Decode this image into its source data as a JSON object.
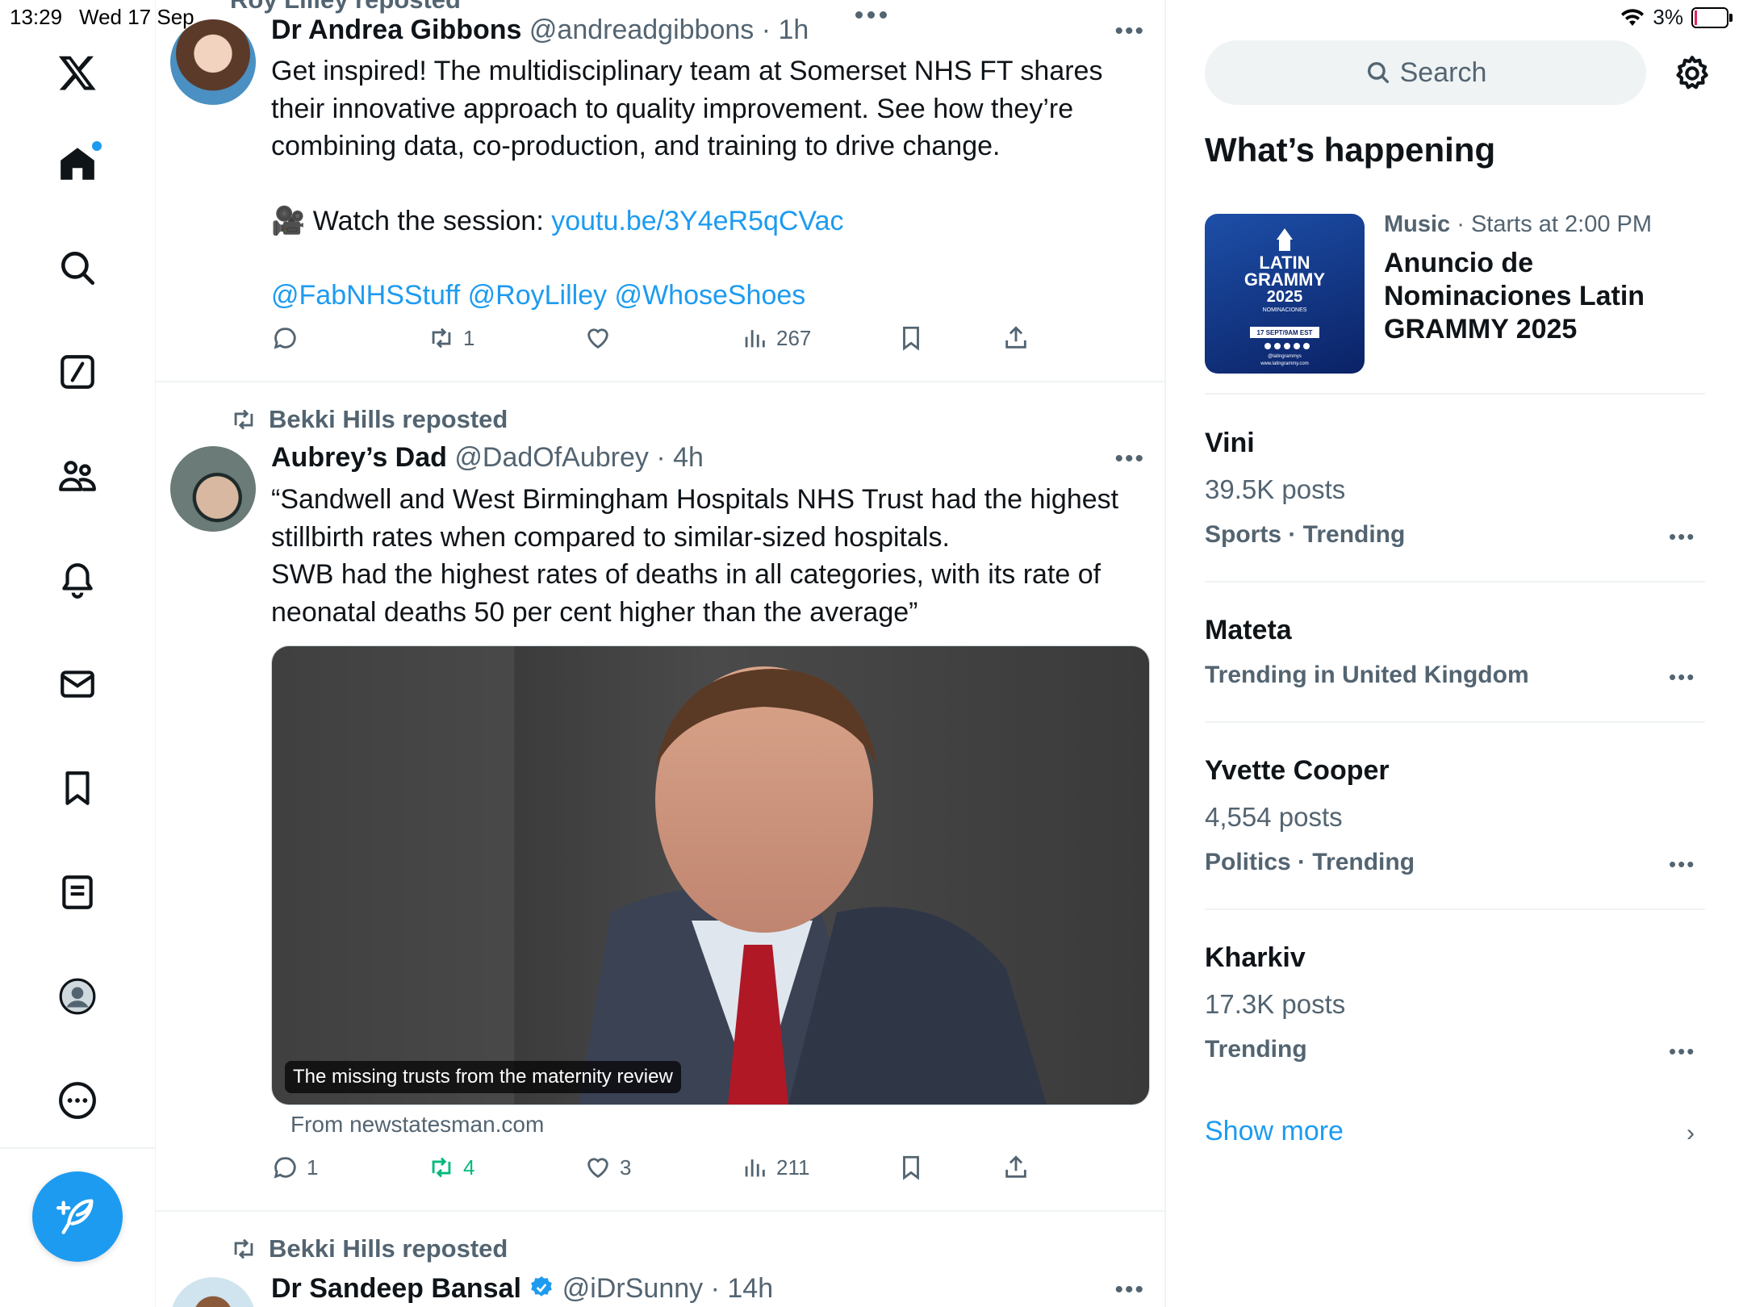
{
  "status_bar": {
    "time": "13:29",
    "date": "Wed 17 Sep",
    "battery_percent": "3%"
  },
  "nav": {
    "items": [
      "x-logo",
      "home",
      "explore",
      "grok",
      "communities",
      "notifications",
      "messages",
      "bookmarks",
      "lists",
      "profile",
      "more"
    ],
    "compose_label": "Post"
  },
  "feed": {
    "top_partial_repost": "Roy Lilley reposted",
    "tweet1": {
      "name": "Dr Andrea Gibbons",
      "handle": "@andreadgibbons",
      "time": "1h",
      "text_lines": [
        "Get inspired! The multidisciplinary team at Somerset NHS FT shares",
        "their innovative approach to quality improvement. See how they’re",
        "combining data, co-production, and training to drive change."
      ],
      "watch_prefix": "🎥 Watch the session: ",
      "watch_link": "youtu.be/3Y4eR5qCVac",
      "mentions": "@FabNHSStuff @RoyLilley @WhoseShoes",
      "replies": "",
      "reposts": "1",
      "likes": "",
      "views": "267"
    },
    "tweet2": {
      "repost_label": "Bekki Hills reposted",
      "name": "Aubrey’s Dad",
      "handle": "@DadOfAubrey",
      "time": "4h",
      "text_lines": [
        "“Sandwell and West Birmingham Hospitals NHS Trust had the highest",
        "stillbirth rates when compared to similar-sized hospitals.",
        "SWB had the highest rates of deaths in all categories, with its rate of",
        "neonatal deaths 50 per cent higher than the average”"
      ],
      "card_caption": "The missing trusts from the maternity review",
      "card_source": "From newstatesman.com",
      "replies": "1",
      "reposts": "4",
      "likes": "3",
      "views": "211"
    },
    "tweet3": {
      "repost_label": "Bekki Hills reposted",
      "name": "Dr Sandeep Bansal",
      "handle": "@iDrSunny",
      "time": "14h"
    }
  },
  "sidebar": {
    "search_placeholder": "Search",
    "section_title": "What’s happening",
    "promo": {
      "category": "Music",
      "meta": "Starts at 2:00 PM",
      "title": "Anuncio de Nominaciones Latin GRAMMY 2025",
      "image_text": [
        "LATIN",
        "GRAMMY",
        "2025",
        "NOMINACIONES",
        "17 SEPT/9AM EST",
        "@latingrammys",
        "www.latingrammy.com"
      ]
    },
    "trends": [
      {
        "title": "Vini",
        "posts": "39.5K posts",
        "category": "Sports · Trending"
      },
      {
        "title": "Mateta",
        "posts": "",
        "category": "Trending in United Kingdom"
      },
      {
        "title": "Yvette Cooper",
        "posts": "4,554 posts",
        "category": "Politics · Trending"
      },
      {
        "title": "Kharkiv",
        "posts": "17.3K posts",
        "category": "Trending"
      }
    ],
    "show_more": "Show more"
  }
}
